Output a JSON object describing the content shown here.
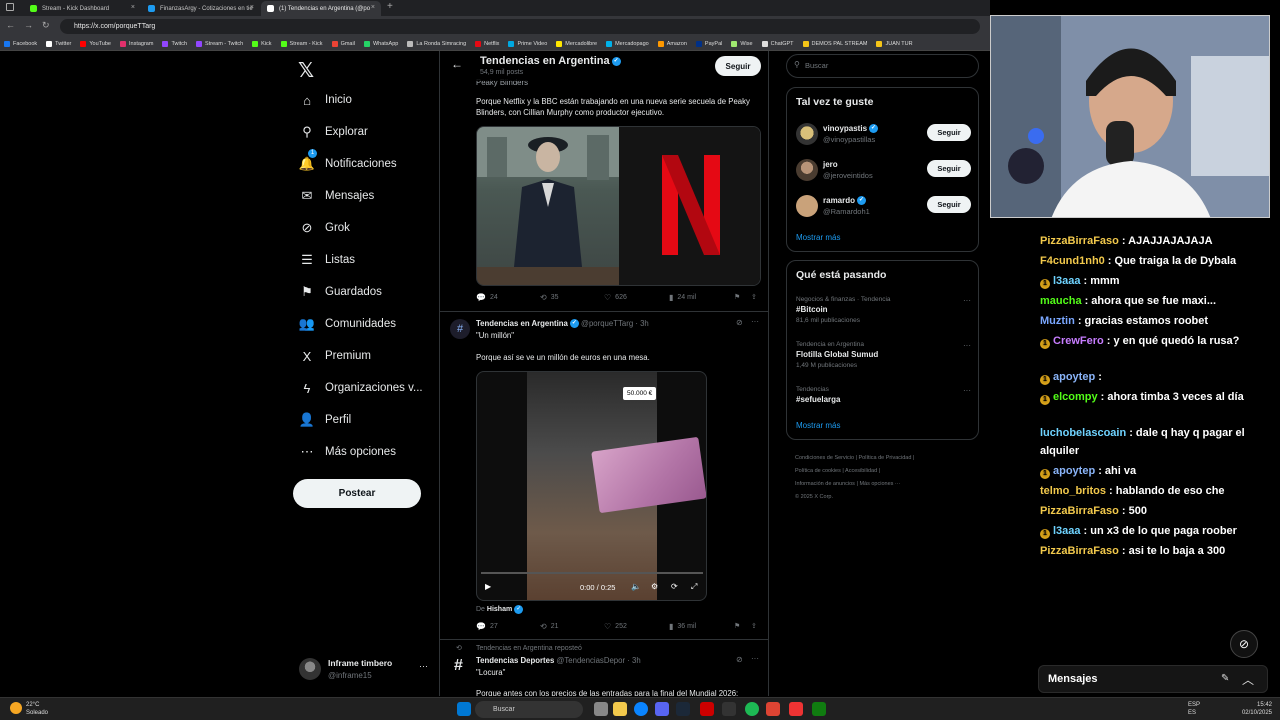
{
  "browser": {
    "tabs": [
      {
        "label": "Stream - Kick Dashboard",
        "color": "#53fc18"
      },
      {
        "label": "FinanzasArgy - Cotizaciones en tie",
        "color": "#1d9bf0"
      },
      {
        "label": "(1) Tendencias en Argentina (@po",
        "color": "#ffffff"
      }
    ],
    "url": "https://x.com/porqueTTarg",
    "bookmarks": [
      "Facebook",
      "Twitter",
      "YouTube",
      "Instagram",
      "Twitch",
      "Stream - Twitch",
      "Kick",
      "Stream - Kick",
      "Gmail",
      "WhatsApp",
      "La Ronda Simracing",
      "Netflix",
      "Prime Video",
      "Mercadolibre",
      "Mercadopago",
      "Amazon",
      "PayPal",
      "Wise",
      "ChatGPT",
      "DEMOS PAL STREAM",
      "JUAN TUR"
    ]
  },
  "sidebar": {
    "items": [
      {
        "label": "Inicio",
        "icon": "home-icon",
        "glyph": "⌂"
      },
      {
        "label": "Explorar",
        "icon": "search-icon",
        "glyph": "⚲"
      },
      {
        "label": "Notificaciones",
        "icon": "bell-icon",
        "glyph": "🔔",
        "badge": "1"
      },
      {
        "label": "Mensajes",
        "icon": "mail-icon",
        "glyph": "✉"
      },
      {
        "label": "Grok",
        "icon": "grok-icon",
        "glyph": "⊘"
      },
      {
        "label": "Listas",
        "icon": "list-icon",
        "glyph": "☰"
      },
      {
        "label": "Guardados",
        "icon": "bookmark-icon",
        "glyph": "⚑"
      },
      {
        "label": "Comunidades",
        "icon": "people-icon",
        "glyph": "👥"
      },
      {
        "label": "Premium",
        "icon": "x-premium-icon",
        "glyph": "X"
      },
      {
        "label": "Organizaciones v...",
        "icon": "lightning-icon",
        "glyph": "ϟ"
      },
      {
        "label": "Perfil",
        "icon": "person-icon",
        "glyph": "👤"
      },
      {
        "label": "Más opciones",
        "icon": "more-circle-icon",
        "glyph": "⋯"
      }
    ],
    "post_label": "Postear",
    "account": {
      "name": "Inframe timbero",
      "handle": "@inframe15"
    }
  },
  "feed": {
    "header_title": "Tendencias en Argentina",
    "header_sub": "54,9 mil posts",
    "follow_label": "Seguir",
    "tweet1": {
      "cut_text": "Peaky Blinders",
      "text": "Porque Netflix y la BBC están trabajando en una nueva serie secuela de Peaky Blinders, con Cillian Murphy como productor ejecutivo.",
      "replies": "24",
      "reposts": "35",
      "likes": "626",
      "views": "24 mil"
    },
    "tweet2": {
      "name": "Tendencias en Argentina",
      "handle": "@porqueTTarg · 3h",
      "quote": "\"Un millón\"",
      "text": "Porque así se ve un millón de euros en una mesa.",
      "price_tag": "50.000 €",
      "video_time": "0:00 / 0:25",
      "from_prefix": "De",
      "from_name": "Hisham",
      "replies": "27",
      "reposts": "21",
      "likes": "252",
      "views": "36 mil"
    },
    "tweet3": {
      "repost_note": "Tendencias en Argentina reposteó",
      "name": "Tendencias Deportes",
      "handle": "@TendenciasDepor · 3h",
      "quote": "\"Locura\"",
      "text": "Porque antes con los precios de las entradas para la final del Mundial 2026:"
    }
  },
  "right": {
    "search_placeholder": "Buscar",
    "suggest_title": "Tal vez te guste",
    "suggestions": [
      {
        "name": "vinoypastis",
        "handle": "@vinoypastillas",
        "verified": true,
        "follow": "Seguir"
      },
      {
        "name": "jero",
        "handle": "@jeroveintidos",
        "verified": false,
        "follow": "Seguir"
      },
      {
        "name": "ramardo",
        "handle": "@Ramardoh1",
        "verified": true,
        "follow": "Seguir"
      }
    ],
    "show_more": "Mostrar más",
    "trends_title": "Qué está pasando",
    "trends": [
      {
        "context": "Negocios & finanzas · Tendencia",
        "topic": "#Bitcoin",
        "count": "81,6 mil publicaciones"
      },
      {
        "context": "Tendencia en Argentina",
        "topic": "Flotilla Global Sumud",
        "count": "1,49 M publicaciones"
      },
      {
        "context": "Tendencias",
        "topic": "#sefuelarga",
        "count": ""
      }
    ],
    "trends_more": "Mostrar más",
    "footer": [
      "Condiciones de Servicio",
      "Política de Privacidad",
      "Política de cookies",
      "Accesibilidad",
      "Información de anuncios",
      "Más opciones ···",
      "© 2025 X Corp."
    ]
  },
  "chat": {
    "messages": [
      {
        "user": "PizzaBirraFaso",
        "color": "#f2c94c",
        "text": ": AJAJJAJAJAJA",
        "badge": false
      },
      {
        "user": "F4cund1nh0",
        "color": "#f2c94c",
        "text": ": Que traiga la de Dybala",
        "badge": false
      },
      {
        "user": "l3aaa",
        "color": "#6fd3ff",
        "text": ": mmm",
        "badge": true
      },
      {
        "user": "maucha",
        "color": "#53fc18",
        "text": ": ahora que se fue maxi...",
        "badge": false
      },
      {
        "user": "Muztin",
        "color": "#7aa7ff",
        "text": ": gracias estamos roobet",
        "badge": false
      },
      {
        "user": "CrewFero",
        "color": "#c77dff",
        "text": ": y en qué quedó la rusa?",
        "badge": true
      },
      {
        "user": "apoytep",
        "color": "#8ab4f8",
        "text": ":",
        "badge": true
      },
      {
        "user": "elcompy",
        "color": "#53fc18",
        "text": ": ahora timba 3 veces al día",
        "badge": true
      },
      {
        "user": "luchobelascoain",
        "color": "#6fd3ff",
        "text": ": dale q hay q pagar el alquiler",
        "badge": false
      },
      {
        "user": "apoytep",
        "color": "#8ab4f8",
        "text": ": ahi va",
        "badge": true
      },
      {
        "user": "telmo_britos",
        "color": "#f2c94c",
        "text": ": hablando de eso che",
        "badge": false
      },
      {
        "user": "PizzaBirraFaso",
        "color": "#f2c94c",
        "text": ": 500",
        "badge": false
      },
      {
        "user": "l3aaa",
        "color": "#6fd3ff",
        "text": ": un x3 de lo que paga roober",
        "badge": true
      },
      {
        "user": "PizzaBirraFaso",
        "color": "#f2c94c",
        "text": ": asi te lo baja a 300",
        "badge": false
      }
    ],
    "footer_label": "Mensajes"
  },
  "taskbar": {
    "weather_temp": "22°C",
    "weather_desc": "Soleado",
    "search": "Buscar",
    "lang1": "ESP",
    "lang2": "ES",
    "time": "15:42",
    "date": "02/10/2025"
  }
}
